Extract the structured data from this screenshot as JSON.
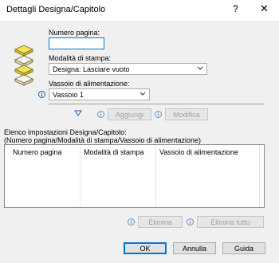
{
  "window": {
    "title": "Dettagli Designa/Capitolo",
    "help_glyph": "?",
    "close_glyph": "✕"
  },
  "page_number": {
    "label": "Numero pagina:",
    "value": ""
  },
  "print_mode": {
    "label": "Modalità di stampa:",
    "selected": "Designa: Lasciare vuoto"
  },
  "tray": {
    "label": "Vassoio di alimentazione:",
    "selected": "Vassoio 1"
  },
  "actions": {
    "add_label": "Aggiungi",
    "edit_label": "Modifica"
  },
  "list": {
    "title_line1": "Elenco impostazioni Designa/Capitolo:",
    "title_line2": "(Numero pagina/Modalità di stampa/Vassoio di alimentazione)",
    "columns": [
      "Numero pagina",
      "Modalità di stampa",
      "Vassoio di alimentazione"
    ],
    "rows": []
  },
  "list_actions": {
    "delete_label": "Elimina",
    "delete_all_label": "Elimina tutto"
  },
  "footer": {
    "ok_label": "OK",
    "cancel_label": "Annulla",
    "help_label": "Guida"
  },
  "colors": {
    "accent": "#0078d7",
    "info": "#1a5fb4",
    "stack_yellow": "#f2e35a"
  }
}
